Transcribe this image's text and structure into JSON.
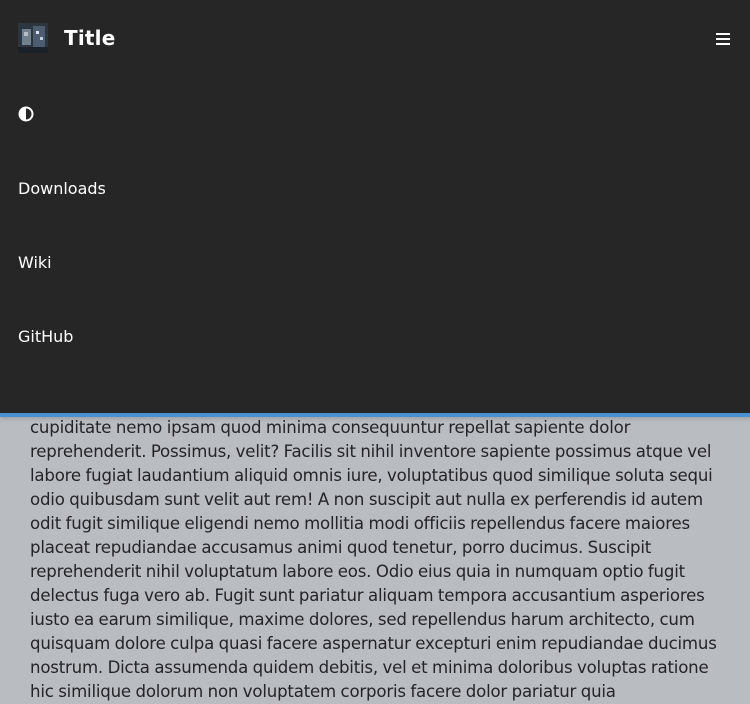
{
  "navbar": {
    "title": "Title",
    "links": [
      {
        "label": "Downloads"
      },
      {
        "label": "Wiki"
      },
      {
        "label": "GitHub"
      }
    ],
    "icons": {
      "logo": "app-logo-image",
      "theme": "contrast-icon",
      "menu": "hamburger-menu-icon"
    },
    "colors": {
      "background": "#262626",
      "accent_border": "#4a90d4",
      "text": "#ffffff"
    }
  },
  "content": {
    "paragraph": "cupiditate nemo ipsam quod minima consequuntur repellat sapiente dolor reprehenderit. Possimus, velit? Facilis sit nihil inventore sapiente possimus atque vel labore fugiat laudantium aliquid omnis iure, voluptatibus quod similique soluta sequi odio quibusdam sunt velit aut rem! A non suscipit aut nulla ex perferendis id autem odit fugit similique eligendi nemo mollitia modi officiis repellendus facere maiores placeat repudiandae accusamus animi quod tenetur, porro ducimus. Suscipit reprehenderit nihil voluptatum labore eos. Odio eius quia in numquam optio fugit delectus fuga vero ab. Fugit sunt pariatur aliquam tempora accusantium asperiores iusto ea earum similique, maxime dolores, sed repellendus harum architecto, cum quisquam dolore culpa quasi facere aspernatur excepturi enim repudiandae ducimus nostrum. Dicta assumenda quidem debitis, vel et minima doloribus voluptas ratione hic similique dolorum non voluptatem corporis facere dolor pariatur quia",
    "colors": {
      "background": "#b9bdc1",
      "text": "#222428"
    }
  }
}
